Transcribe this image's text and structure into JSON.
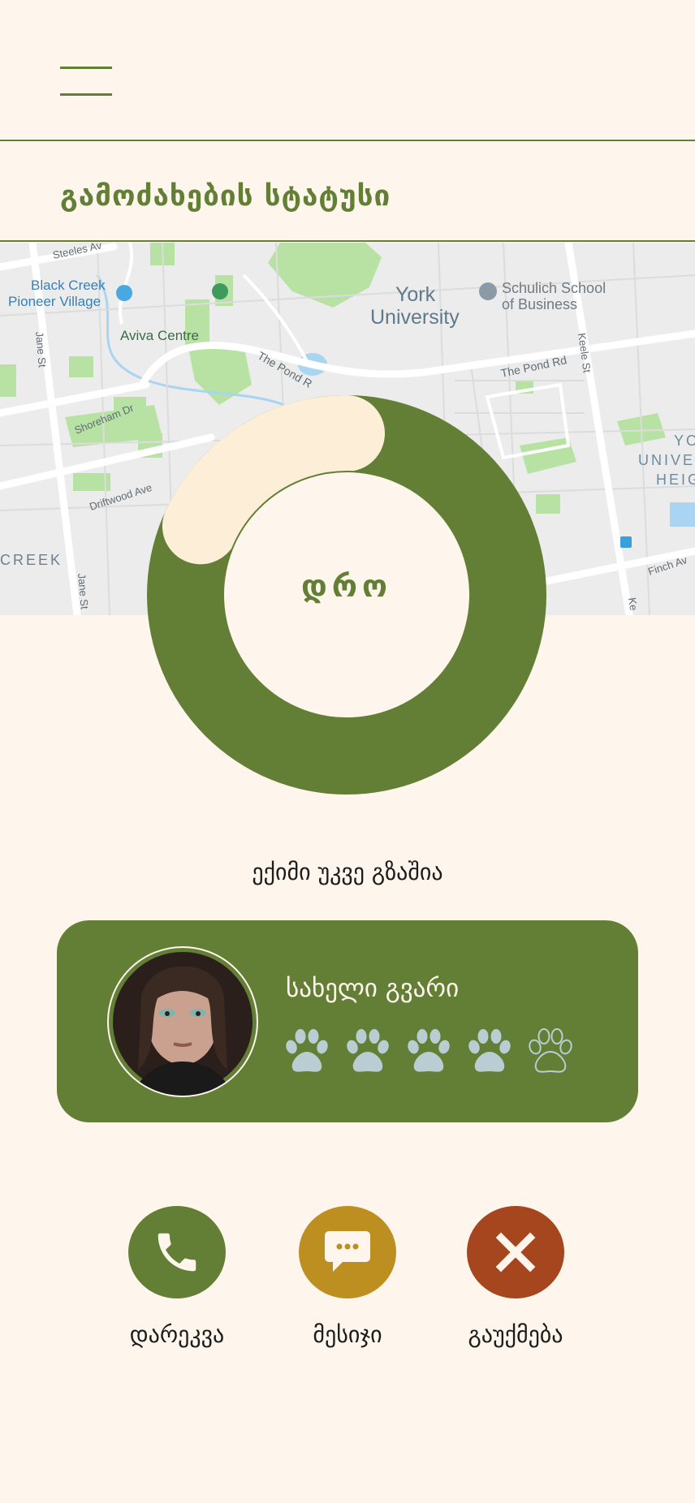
{
  "header": {
    "menu_icon": "hamburger-menu-icon",
    "title": "გამოძახების სტატუსი"
  },
  "map": {
    "labels": {
      "steeles": "Steeles Av",
      "black_creek_1": "Black Creek",
      "black_creek_2": "Pioneer Village",
      "york_1": "York",
      "york_2": "University",
      "schulich_1": "Schulich School",
      "schulich_2": "of Business",
      "aviva": "Aviva Centre",
      "jane_st": "Jane St",
      "jane_st_2": "Jane St",
      "keele_st": "Keele St",
      "keele_st_2": "Ke",
      "pond_rd": "The Pond Rd",
      "pond_rd_2": "The Pond R",
      "shoreham": "Shoreham Dr",
      "driftwood": "Driftwood Ave",
      "creek": "CREEK",
      "york_u_heights_1": "YO",
      "york_u_heights_2": "UNIVE",
      "york_u_heights_3": "HEIG",
      "finch": "Finch Av"
    }
  },
  "timer": {
    "label": "დრო",
    "progress": 0.82
  },
  "status_text": "ექიმი უკვე გზაშია",
  "doctor": {
    "name": "სახელი გვარი",
    "rating": 4,
    "rating_max": 5,
    "avatar_icon": "doctor-avatar"
  },
  "actions": [
    {
      "label": "დარეკვა",
      "icon": "phone-icon",
      "color": "#637f36"
    },
    {
      "label": "მესიჯი",
      "icon": "chat-bubble-icon",
      "color": "#bd8e20"
    },
    {
      "label": "გაუქმება",
      "icon": "close-icon",
      "color": "#a6461f"
    }
  ],
  "colors": {
    "background": "#fef6ec",
    "primary_green": "#637f36",
    "ring_remaining": "#fdeed8",
    "paw_filled": "#b9cdd3",
    "call": "#637f36",
    "message": "#bd8e20",
    "cancel": "#a6461f"
  }
}
